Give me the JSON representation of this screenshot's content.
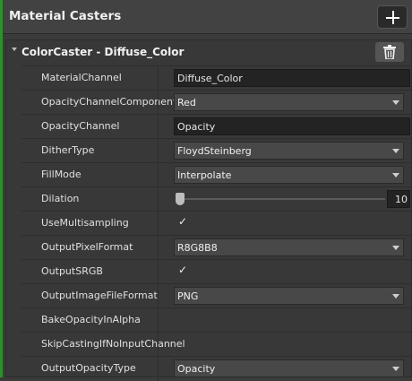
{
  "header": {
    "title": "Material Casters"
  },
  "caster": {
    "title": "ColorCaster - Diffuse_Color",
    "rows": [
      {
        "label": "MaterialChannel",
        "type": "text",
        "value": "Diffuse_Color"
      },
      {
        "label": "OpacityChannelComponent",
        "type": "dropdown",
        "value": "Red"
      },
      {
        "label": "OpacityChannel",
        "type": "text",
        "value": "Opacity"
      },
      {
        "label": "DitherType",
        "type": "dropdown",
        "value": "FloydSteinberg"
      },
      {
        "label": "FillMode",
        "type": "dropdown",
        "value": "Interpolate"
      },
      {
        "label": "Dilation",
        "type": "slider",
        "value": "10"
      },
      {
        "label": "UseMultisampling",
        "type": "checkbox",
        "value": "✓"
      },
      {
        "label": "OutputPixelFormat",
        "type": "dropdown",
        "value": "R8G8B8"
      },
      {
        "label": "OutputSRGB",
        "type": "checkbox",
        "value": "✓"
      },
      {
        "label": "OutputImageFileFormat",
        "type": "dropdown",
        "value": "PNG"
      },
      {
        "label": "BakeOpacityInAlpha",
        "type": "checkbox",
        "value": ""
      },
      {
        "label": "SkipCastingIfNoInputChannel",
        "type": "checkbox",
        "value": ""
      },
      {
        "label": "OutputOpacityType",
        "type": "dropdown",
        "value": "Opacity"
      }
    ]
  },
  "colors": {
    "accent_edge": "#2f8f2f",
    "panel_bg": "#3b3b3b",
    "field_bg": "#232323"
  },
  "icons": {
    "add": "plus-icon",
    "remove": "trash-icon",
    "collapse": "collapse-triangle-icon"
  }
}
